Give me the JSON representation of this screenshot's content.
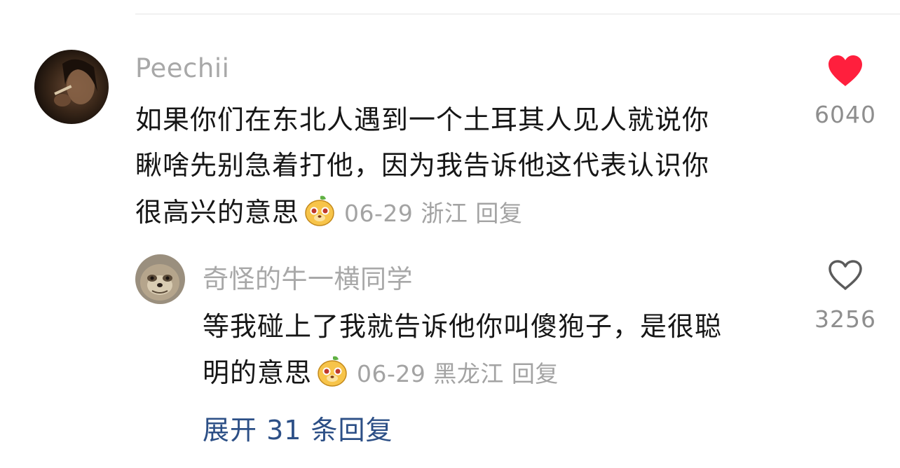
{
  "comment": {
    "username": "Peechii",
    "lines": [
      "如果你们在东北人遇到一个土耳其人见人就说你",
      "瞅啥先别急着打他，因为我告诉他这代表认识你",
      "很高兴的意思"
    ],
    "date": "06-29",
    "location": "浙江",
    "reply_label": "回复",
    "likes": "6040",
    "liked": true
  },
  "reply": {
    "username": "奇怪的牛一横同学",
    "lines": [
      "等我碰上了我就告诉他你叫傻狍子，是很聪",
      "明的意思"
    ],
    "date": "06-29",
    "location": "黑龙江",
    "reply_label": "回复",
    "likes": "3256",
    "liked": false
  },
  "expand_label": "展开 31 条回复",
  "colors": {
    "heart_active": "#ff1f3d",
    "link": "#2c4f86"
  }
}
